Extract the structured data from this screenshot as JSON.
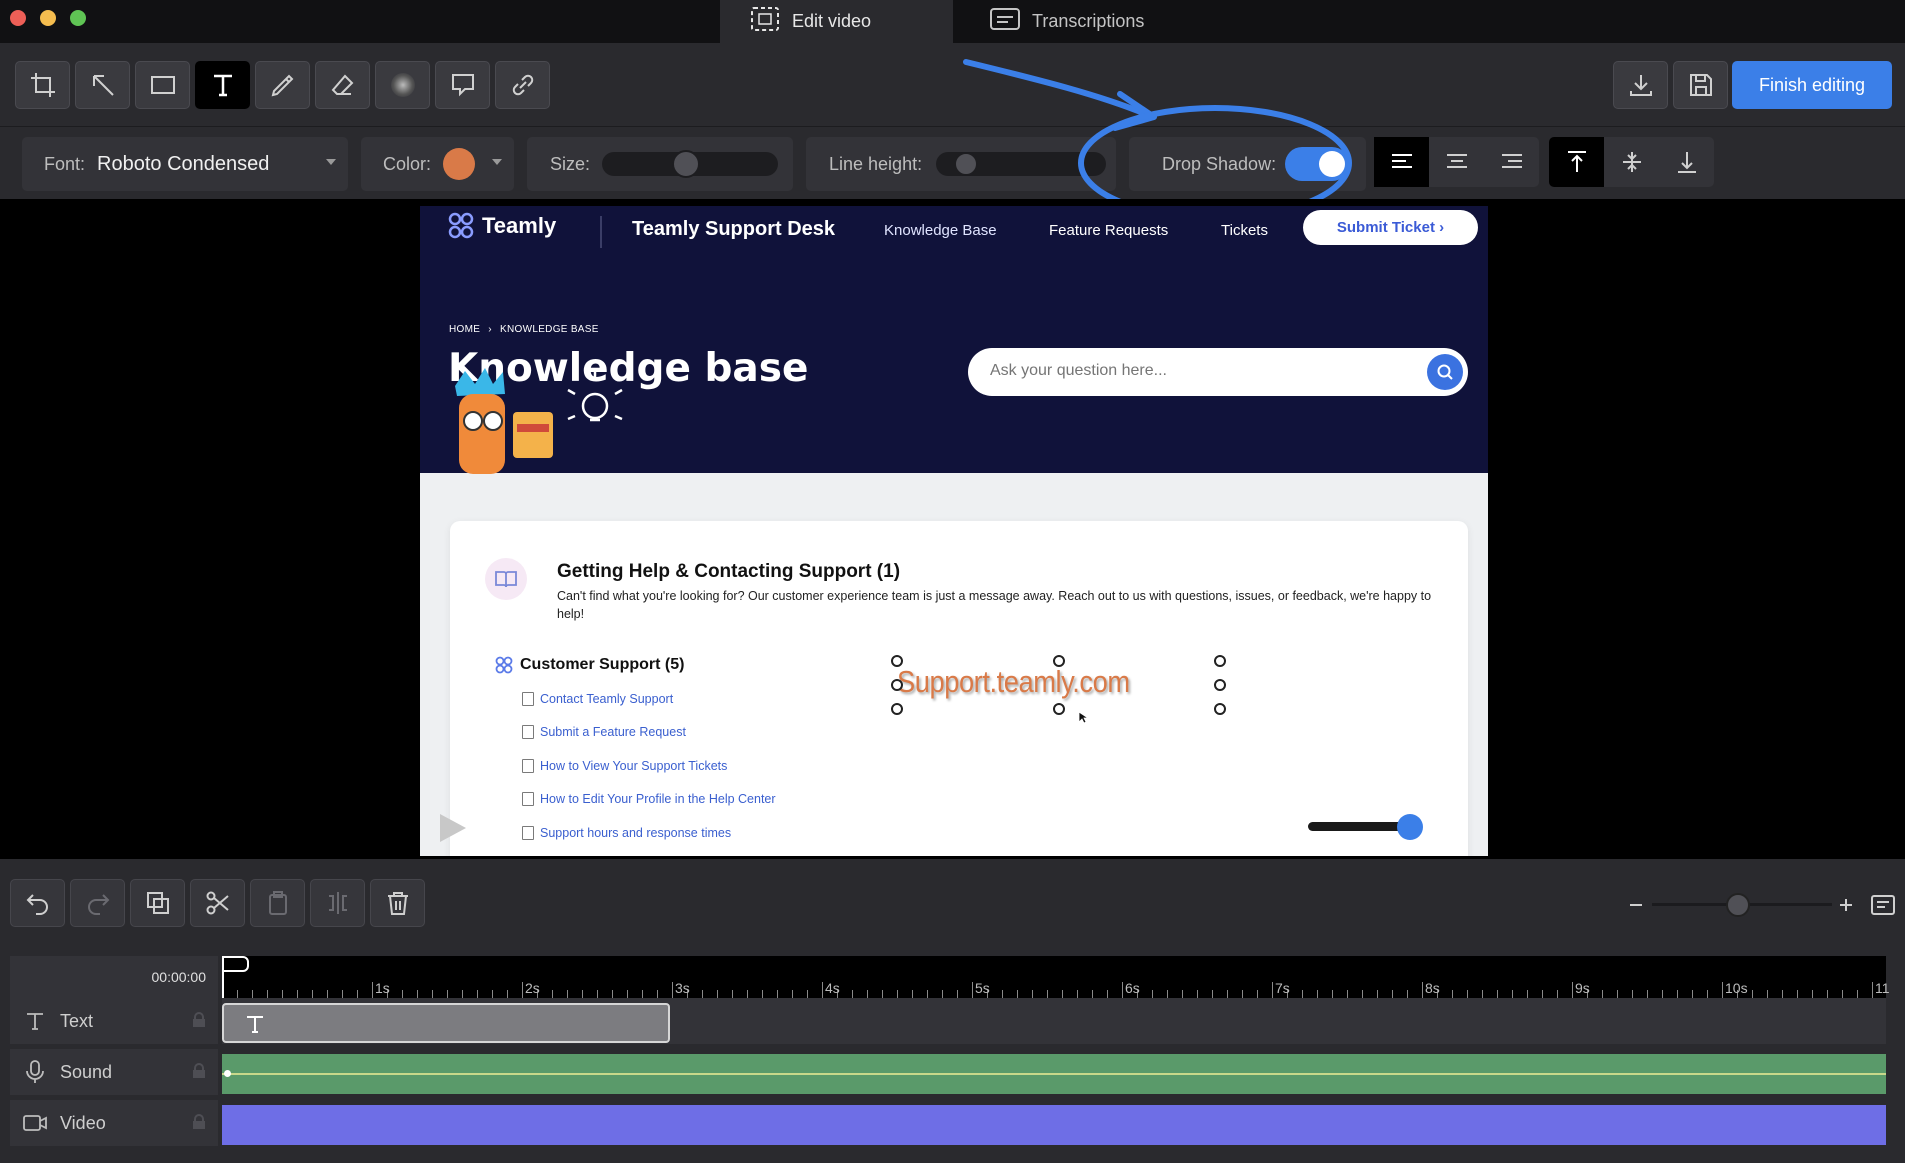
{
  "titlebar": {
    "tabs": [
      {
        "label": "Edit video",
        "icon": "dashed-frame-icon",
        "active": true
      },
      {
        "label": "Transcriptions",
        "icon": "captions-icon",
        "active": false
      }
    ]
  },
  "toolbar": {
    "tools": [
      "crop-icon",
      "arrow-icon",
      "rectangle-icon",
      "text-icon",
      "pen-icon",
      "eraser-icon",
      "blur-icon",
      "speech-bubble-icon",
      "link-icon"
    ],
    "selected_tool": "text-icon",
    "finish_label": "Finish editing"
  },
  "text_options": {
    "font_label": "Font:",
    "font_value": "Roboto Condensed",
    "color_label": "Color:",
    "color_value": "#d97a48",
    "size_label": "Size:",
    "line_height_label": "Line height:",
    "drop_shadow_label": "Drop Shadow:",
    "drop_shadow_on": true
  },
  "site": {
    "brand": "Teamly",
    "desk_title": "Teamly Support Desk",
    "nav": [
      "Knowledge Base",
      "Feature Requests",
      "Tickets"
    ],
    "submit_ticket": "Submit Ticket ›",
    "breadcrumb_home": "HOME",
    "breadcrumb_sep": "›",
    "breadcrumb_current": "KNOWLEDGE BASE",
    "page_title": "Knowledge base",
    "search_placeholder": "Ask your question here...",
    "section_title": "Getting Help & Contacting Support (1)",
    "section_desc": "Can't find what you're looking for? Our customer experience team is just a message away. Reach out to us with questions, issues, or feedback, we're happy to help!",
    "subsection_title": "Customer Support (5)",
    "articles": [
      "Contact Teamly Support",
      "Submit a Feature Request",
      "How to View Your Support Tickets",
      "How to Edit Your Profile in the Help Center",
      "Support hours and response times"
    ],
    "overlay_text": "Support.teamly.com"
  },
  "timeline": {
    "timecode": "00:00:00",
    "seconds": [
      "1s",
      "2s",
      "3s",
      "4s",
      "5s",
      "6s",
      "7s",
      "8s",
      "9s",
      "10s",
      "11"
    ],
    "tracks": [
      {
        "label": "Text",
        "icon": "text-icon"
      },
      {
        "label": "Sound",
        "icon": "microphone-icon"
      },
      {
        "label": "Video",
        "icon": "video-camera-icon"
      }
    ],
    "colors": {
      "sound": "#5a9a6a",
      "video": "#6e6ee6",
      "text_clip": "#7c7c80"
    }
  }
}
